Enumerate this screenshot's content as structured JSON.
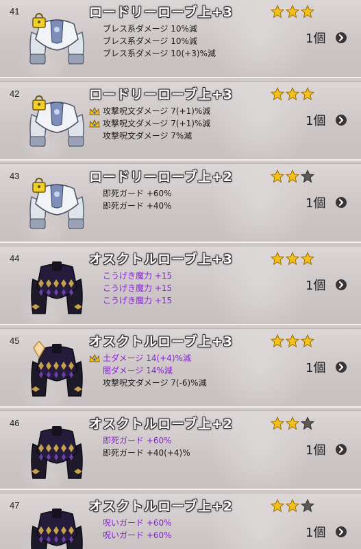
{
  "items": [
    {
      "number": "41",
      "name": "ロードリーローブ上+3",
      "stars": 3,
      "robe": "white",
      "badge": "lock",
      "count": "1個",
      "effects": [
        {
          "text": "ブレス系ダメージ 10%減",
          "color": "black",
          "crown": false
        },
        {
          "text": "ブレス系ダメージ 10%減",
          "color": "black",
          "crown": false
        },
        {
          "text": "ブレス系ダメージ 10(+3)%減",
          "color": "black",
          "crown": false
        }
      ]
    },
    {
      "number": "42",
      "name": "ロードリーローブ上+3",
      "stars": 3,
      "robe": "white",
      "badge": "lock",
      "count": "1個",
      "effects": [
        {
          "text": "攻撃呪文ダメージ 7(+1)%減",
          "color": "black",
          "crown": true
        },
        {
          "text": "攻撃呪文ダメージ 7(+1)%減",
          "color": "black",
          "crown": true
        },
        {
          "text": "攻撃呪文ダメージ 7%減",
          "color": "black",
          "crown": false
        }
      ]
    },
    {
      "number": "43",
      "name": "ロードリーローブ上+2",
      "stars": 2,
      "robe": "white",
      "badge": "lock",
      "count": "1個",
      "effects": [
        {
          "text": "即死ガード +60%",
          "color": "black",
          "crown": false
        },
        {
          "text": "即死ガード +40%",
          "color": "black",
          "crown": false
        }
      ]
    },
    {
      "number": "44",
      "name": "オスクトルローブ上+3",
      "stars": 3,
      "robe": "dark",
      "badge": "none",
      "count": "1個",
      "effects": [
        {
          "text": "こうげき魔力 +15",
          "color": "purple",
          "crown": false
        },
        {
          "text": "こうげき魔力 +15",
          "color": "purple",
          "crown": false
        },
        {
          "text": "こうげき魔力 +15",
          "color": "purple",
          "crown": false
        }
      ]
    },
    {
      "number": "45",
      "name": "オスクトルローブ上+3",
      "stars": 3,
      "robe": "dark",
      "badge": "gem",
      "count": "1個",
      "effects": [
        {
          "text": "土ダメージ 14(+4)%減",
          "color": "purple",
          "crown": true
        },
        {
          "text": "闇ダメージ 14%減",
          "color": "purple",
          "crown": false
        },
        {
          "text": "攻撃呪文ダメージ 7(-6)%減",
          "color": "black",
          "crown": false
        }
      ]
    },
    {
      "number": "46",
      "name": "オスクトルローブ上+2",
      "stars": 2,
      "robe": "dark",
      "badge": "none",
      "count": "1個",
      "effects": [
        {
          "text": "即死ガード +60%",
          "color": "purple",
          "crown": false
        },
        {
          "text": "即死ガード +40(+4)%",
          "color": "black",
          "crown": false
        }
      ]
    },
    {
      "number": "47",
      "name": "オスクトルローブ上+2",
      "stars": 2,
      "robe": "dark",
      "badge": "none",
      "count": "1個",
      "effects": [
        {
          "text": "呪いガード +60%",
          "color": "purple",
          "crown": false
        },
        {
          "text": "呪いガード +60%",
          "color": "purple",
          "crown": false
        }
      ]
    }
  ],
  "colors": {
    "star_on": "#f4c21b",
    "star_off": "#5c5858",
    "effect_purple": "#8a21d6",
    "name_text": "#ffffff"
  }
}
